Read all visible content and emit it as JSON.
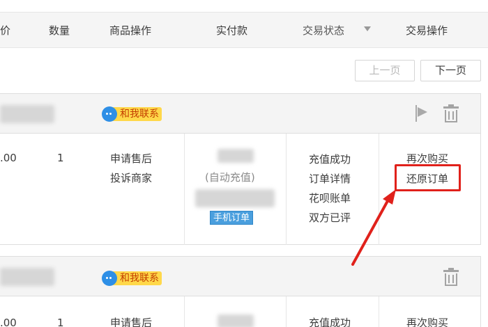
{
  "table_header": {
    "price_partial": "价",
    "quantity": "数量",
    "item_ops": "商品操作",
    "paid": "实付款",
    "status": "交易状态",
    "trade_ops": "交易操作"
  },
  "pager": {
    "prev": "上一页",
    "next": "下一页"
  },
  "orders": [
    {
      "contact_label": "和我联系",
      "price_partial": ".00",
      "quantity": "1",
      "item_ops": [
        "申请售后",
        "投诉商家"
      ],
      "paid_note": "(自动充值)",
      "mobile_tag": "手机订单",
      "status_lines": [
        "充值成功",
        "订单详情",
        "花呗账单",
        "双方已评"
      ],
      "trade_ops": [
        "再次购买",
        "还原订单"
      ]
    },
    {
      "contact_label": "和我联系",
      "price_partial": ".00",
      "quantity": "1",
      "item_ops": [
        "申请售后"
      ],
      "status_lines": [
        "充值成功"
      ],
      "trade_ops": [
        "再次购买"
      ]
    }
  ],
  "colors": {
    "highlight": "#e0211b",
    "contact_badge": "#ffd84a",
    "mobile_tag": "#4a9fde"
  },
  "icons": [
    "chat-bubble-icon",
    "flag-icon",
    "trash-icon",
    "sort-triangle-icon"
  ]
}
